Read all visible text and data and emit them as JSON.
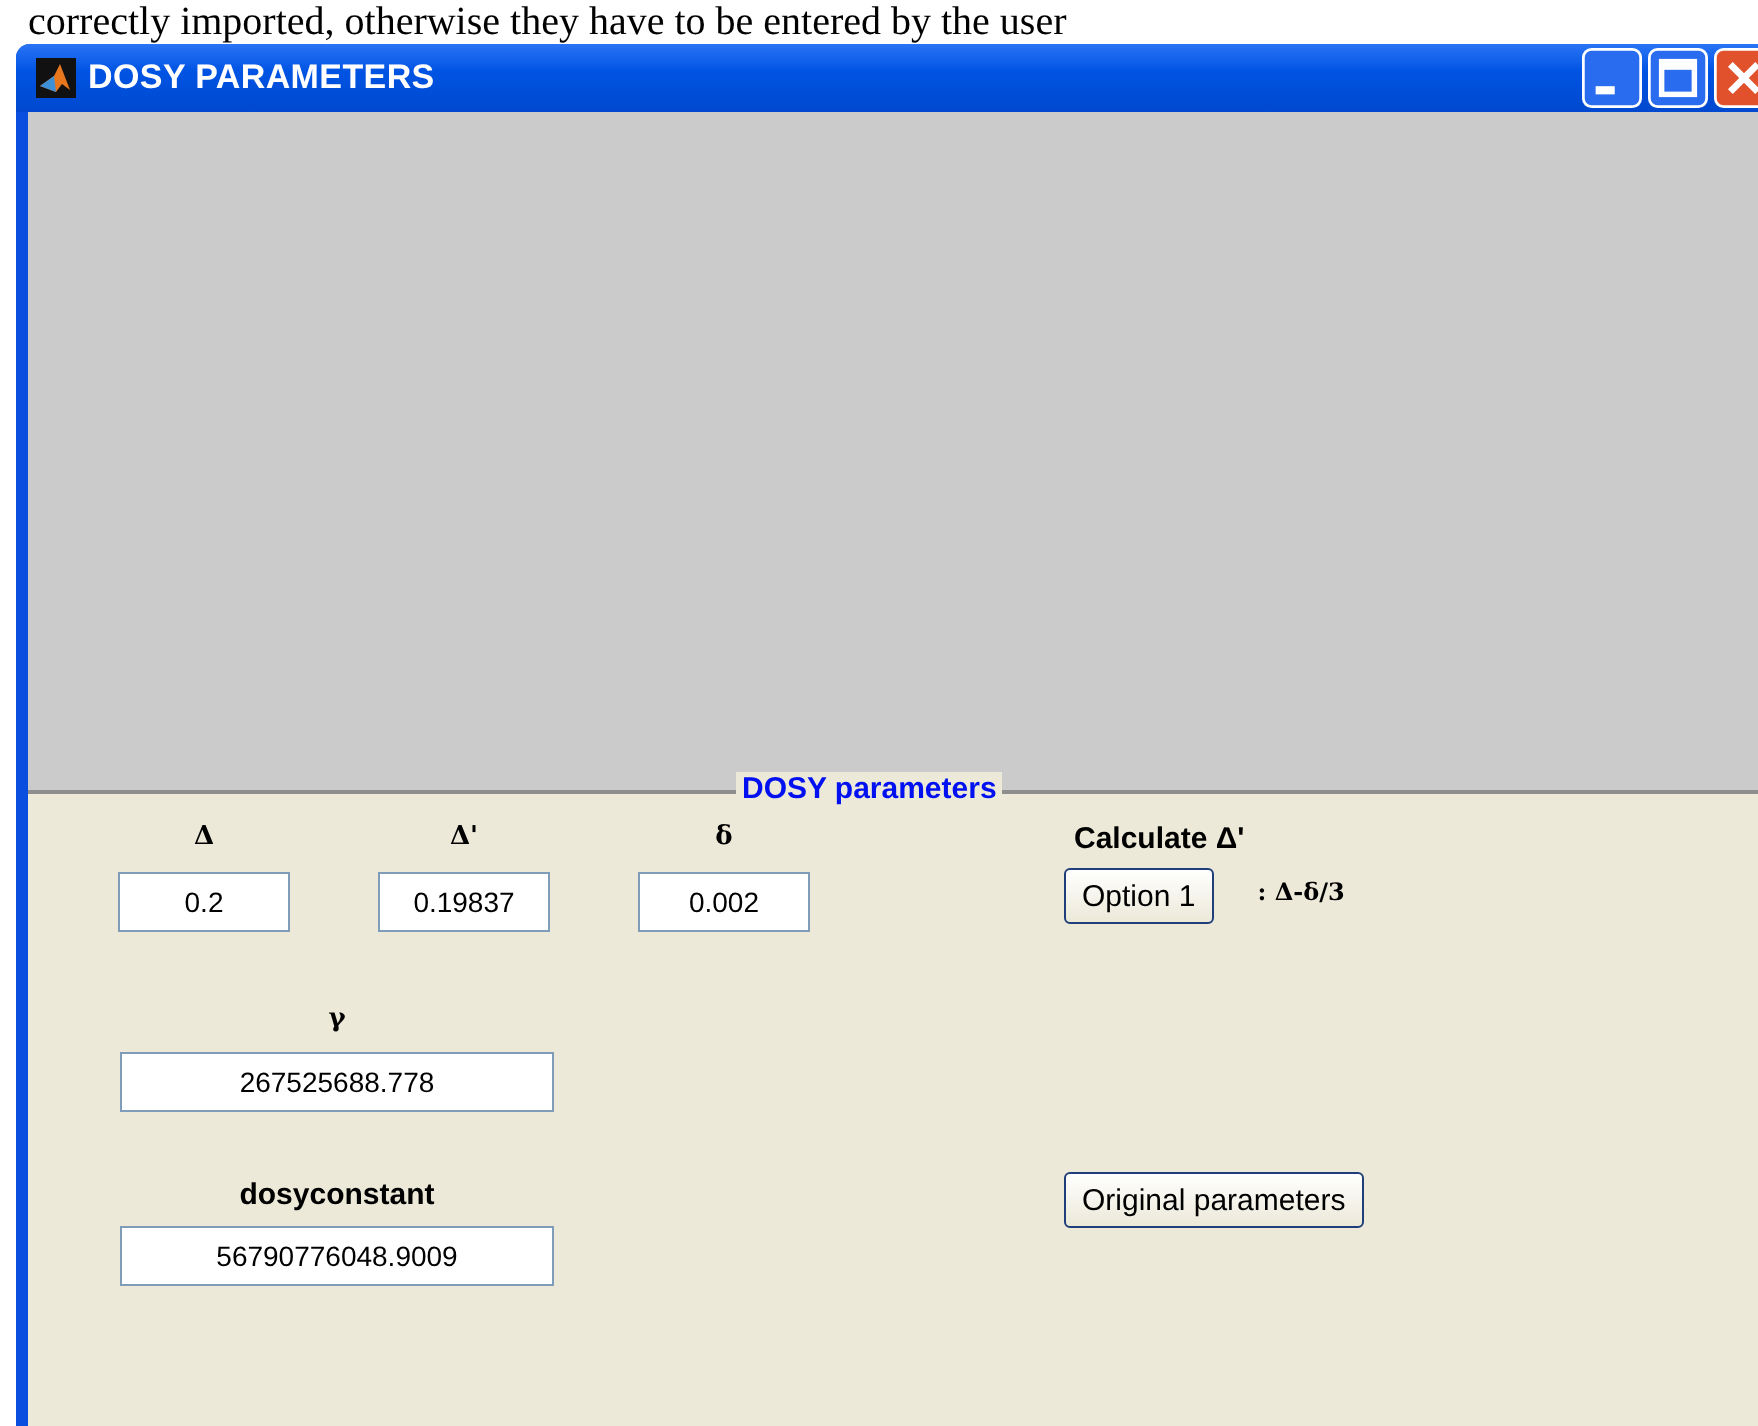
{
  "document_text": "correctly imported, otherwise they have to be entered by the user",
  "window": {
    "title": "DOSY PARAMETERS"
  },
  "panel": {
    "title": "DOSY parameters",
    "parameters": [
      {
        "label": "Δ",
        "value": "0.2"
      },
      {
        "label": "Δ'",
        "value": "0.19837"
      },
      {
        "label": "δ",
        "value": "0.002"
      }
    ],
    "gamma": {
      "label": "γ",
      "value": "267525688.778"
    },
    "dosyconstant": {
      "label": "dosyconstant",
      "value": "56790776048.9009"
    },
    "calculate": {
      "title": "Calculate Δ'",
      "button": "Option 1",
      "formula": ": Δ-δ/3"
    },
    "reset_button": "Original parameters"
  }
}
